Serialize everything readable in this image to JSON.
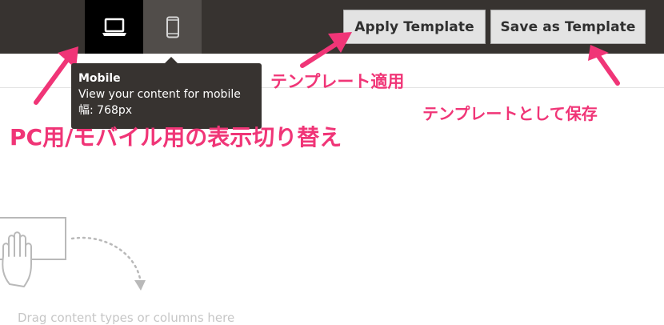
{
  "toolbar": {
    "view_modes": [
      {
        "name": "desktop",
        "icon": "laptop-icon",
        "active": true
      },
      {
        "name": "mobile",
        "icon": "smartphone-icon",
        "active": false
      }
    ],
    "apply_template_label": "Apply Template",
    "save_as_template_label": "Save as Template"
  },
  "tooltip": {
    "title": "Mobile",
    "description": "View your content for mobile",
    "width_text": "幅: 768px"
  },
  "annotations": {
    "apply_template": "テンプレート適用",
    "save_as_template": "テンプレートとして保存",
    "view_toggle": "PC用/モバイル用の表示切り替え"
  },
  "stage": {
    "drop_hint": "Drag content types or columns here",
    "icon": "hand-drag-icon"
  },
  "colors": {
    "topbar": "#373330",
    "active_view": "#000000",
    "annotation": "#f03577",
    "button_bg": "#e3e3e3"
  }
}
